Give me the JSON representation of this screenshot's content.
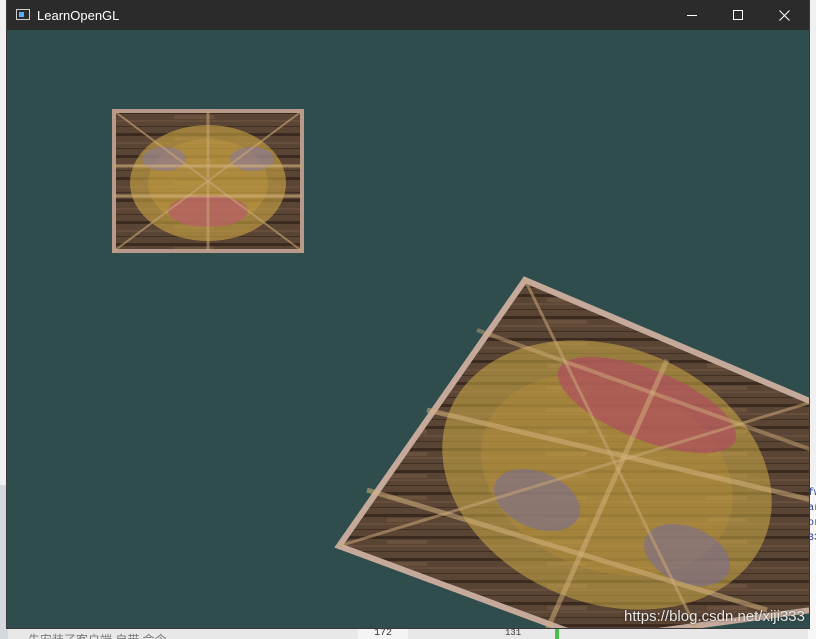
{
  "window": {
    "title": "LearnOpenGL",
    "clear_color": "#304d4d",
    "titlebar_color": "#2b2b2b"
  },
  "controls": {
    "minimize_icon": "minimize-icon",
    "maximize_icon": "maximize-icon",
    "close_icon": "close-icon"
  },
  "scene": {
    "objects": [
      {
        "name": "container-face-small",
        "texture": "wooden-crate-with-awesome-face"
      },
      {
        "name": "container-face-large-rotated",
        "texture": "wooden-crate-with-awesome-face"
      }
    ]
  },
  "watermark": "https://blog.csdn.net/xiji333",
  "background_fragments": {
    "bottom_text": "先安装了客户端 自带 命令",
    "line_number": "172",
    "line_number2": "131"
  }
}
